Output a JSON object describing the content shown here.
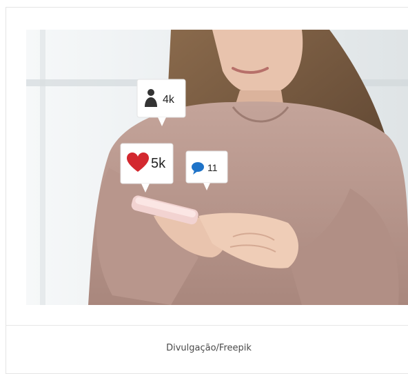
{
  "figure": {
    "caption": "Divulgação/Freepik",
    "notifications": {
      "followers": {
        "icon": "person-icon",
        "value": "4k"
      },
      "likes": {
        "icon": "heart-icon",
        "value": "5k",
        "color": "#d3282f"
      },
      "comments": {
        "icon": "speech-bubble-icon",
        "value": "11",
        "color": "#1e73c8"
      }
    }
  }
}
